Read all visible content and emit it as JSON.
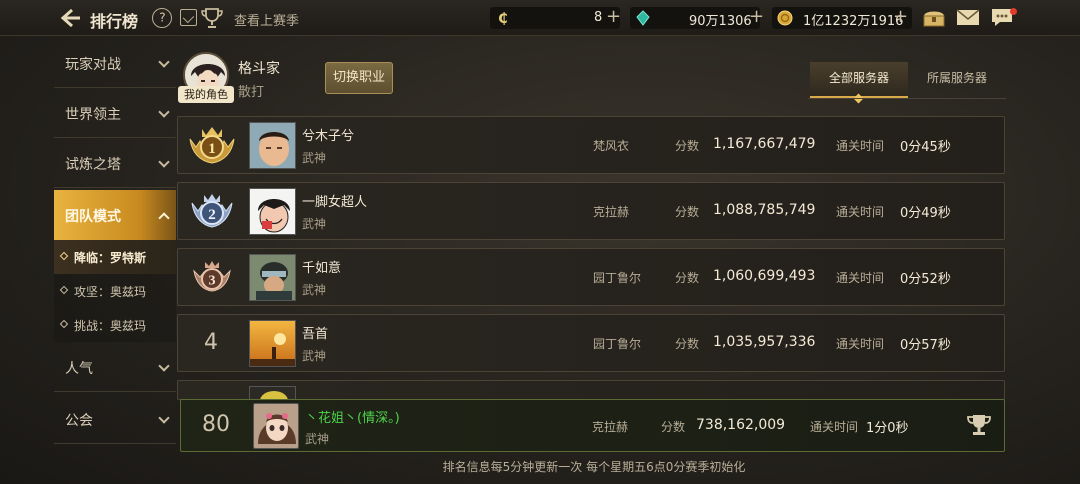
{
  "header": {
    "title": "排行榜",
    "help_label": "?",
    "season_link": "查看上赛季",
    "currencies": [
      {
        "icon": "coin-c-icon",
        "value": "8"
      },
      {
        "icon": "green-gem-icon",
        "value": "90万1306"
      },
      {
        "icon": "gold-coin-icon",
        "value": "1亿1232万1916"
      }
    ],
    "plus_label": "+"
  },
  "sidebar": {
    "items": [
      {
        "label": "玩家对战"
      },
      {
        "label": "世界领主"
      },
      {
        "label": "试炼之塔"
      },
      {
        "label": "团队模式"
      },
      {
        "label": "人气"
      },
      {
        "label": "公会"
      }
    ],
    "sub_items": [
      {
        "label": "降临：罗特斯"
      },
      {
        "label": "攻坚：奥兹玛"
      },
      {
        "label": "挑战：奥兹玛"
      }
    ]
  },
  "profile": {
    "badge": "我的角色",
    "name": "格斗家",
    "class": "散打",
    "switch_label": "切换职业"
  },
  "tabs": {
    "all_servers": "全部服务器",
    "my_server": "所属服务器"
  },
  "labels": {
    "score": "分数",
    "clear_time": "通关时间"
  },
  "rows": [
    {
      "rank": "1",
      "name": "兮木子兮",
      "class": "武神",
      "server": "梵风衣",
      "score": "1,167,667,479",
      "time": "0分45秒"
    },
    {
      "rank": "2",
      "name": "一脚女超人",
      "class": "武神",
      "server": "克拉赫",
      "score": "1,088,785,749",
      "time": "0分49秒"
    },
    {
      "rank": "3",
      "name": "千如意",
      "class": "武神",
      "server": "园丁鲁尔",
      "score": "1,060,699,493",
      "time": "0分52秒"
    },
    {
      "rank": "4",
      "name": "吾首",
      "class": "武神",
      "server": "园丁鲁尔",
      "score": "1,035,957,336",
      "time": "0分57秒"
    }
  ],
  "my_row": {
    "rank": "80",
    "name": "丶花姐丶(情深。)",
    "class": "武神",
    "server": "克拉赫",
    "score": "738,162,009",
    "time": "1分0秒"
  },
  "footer": "排名信息每5分钟更新一次 每个星期五6点0分赛季初始化",
  "colors": {
    "accent": "#d8aa4a",
    "active_tab": "#e8b340",
    "my_name": "#4ed34a"
  }
}
